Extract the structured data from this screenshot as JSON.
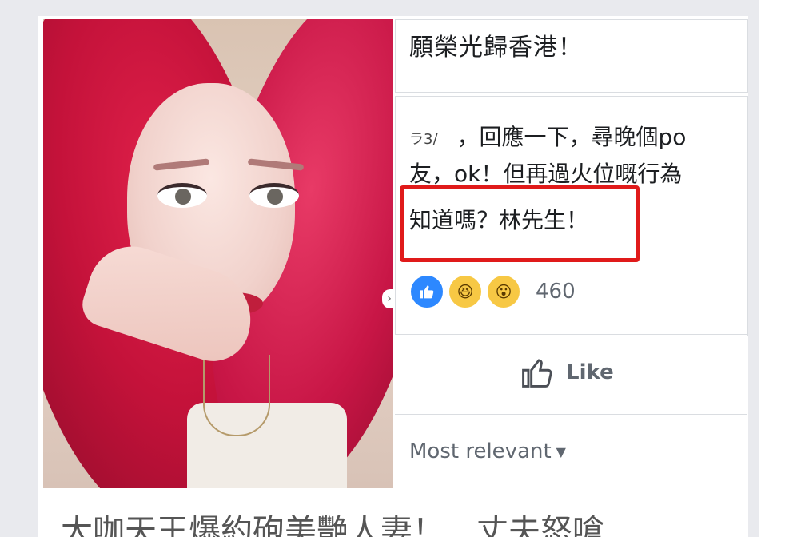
{
  "post": {
    "top_text": "願榮光歸香港！",
    "comment": {
      "line1_prefix": "ラ3/",
      "line1": "，回應一下，尋晚個po",
      "line2": "友，ok！但再過火位嘅行為",
      "line3": "知道嗎？林先生！"
    },
    "reactions": {
      "icons": [
        "like-icon",
        "haha-icon",
        "wow-icon"
      ],
      "count": "460"
    },
    "like_button_label": "Like",
    "sort_label": "Most relevant",
    "caption": "大咖天王爆約砲美艷人妻！　丈夫怒嗆"
  },
  "colors": {
    "highlight": "#e01a1a",
    "like_blue": "#2d88ff",
    "reaction_yellow": "#f7c844",
    "muted_text": "#606770"
  }
}
